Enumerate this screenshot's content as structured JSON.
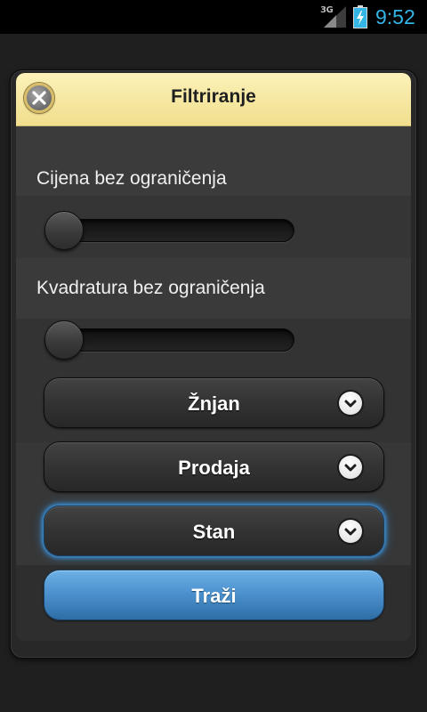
{
  "status_bar": {
    "network_type": "3G",
    "signal_icon": "signal-icon",
    "battery_icon": "battery-charging-icon",
    "time": "9:52"
  },
  "dialog": {
    "title": "Filtriranje",
    "close_icon": "close-icon",
    "filters": {
      "price": {
        "label": "Cijena bez ograničenja",
        "value_fraction": 0
      },
      "area": {
        "label": "Kvadratura bez ograničenja",
        "value_fraction": 0
      }
    },
    "dropdowns": [
      {
        "selected": "Žnjan",
        "icon": "chevron-down-icon",
        "focused": false
      },
      {
        "selected": "Prodaja",
        "icon": "chevron-down-icon",
        "focused": false
      },
      {
        "selected": "Stan",
        "icon": "chevron-down-icon",
        "focused": true
      }
    ],
    "search_button": {
      "label": "Traži"
    }
  },
  "colors": {
    "status_time": "#33b5e5",
    "header_background": "#f6e8a3",
    "focus_glow": "#3b8fd6",
    "button_primary": "#4a8fcb"
  }
}
